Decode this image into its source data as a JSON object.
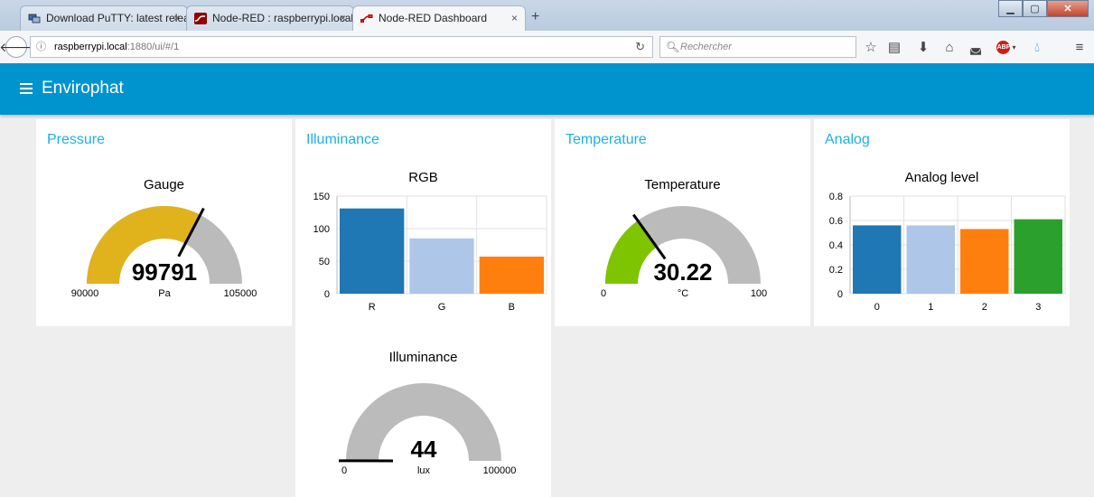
{
  "browser": {
    "tabs": [
      {
        "label": "Download PuTTY: latest relea",
        "close": "×"
      },
      {
        "label": "Node-RED : raspberrypi.local",
        "close": "×"
      },
      {
        "label": "Node-RED Dashboard",
        "close": "×"
      }
    ],
    "new_tab": "+",
    "url_host": "raspberrypi.local",
    "url_rest": ":1880/ui/#/1",
    "search_placeholder": "Rechercher",
    "abp_label": "ABP"
  },
  "app": {
    "title": "Envirophat"
  },
  "groups": {
    "pressure": {
      "title": "Pressure",
      "gauge": {
        "title": "Gauge",
        "value": "99791",
        "value_num": 99791,
        "unit": "Pa",
        "min": "90000",
        "min_num": 90000,
        "max": "105000",
        "max_num": 105000,
        "color": "#e0b21c"
      }
    },
    "illuminance": {
      "title": "Illuminance",
      "gauge": {
        "title": "Illuminance",
        "value": "44",
        "value_num": 44,
        "unit": "lux",
        "min": "0",
        "min_num": 0,
        "max": "100000",
        "max_num": 100000,
        "color": "#000000"
      }
    },
    "temperature": {
      "title": "Temperature",
      "gauge": {
        "title": "Temperature",
        "value": "30.22",
        "value_num": 30.22,
        "unit": "°C",
        "min": "0",
        "min_num": 0,
        "max": "100",
        "max_num": 100,
        "color": "#7ec400"
      }
    },
    "analog": {
      "title": "Analog"
    }
  },
  "chart_data": [
    {
      "type": "bar",
      "title": "RGB",
      "categories": [
        "R",
        "G",
        "B"
      ],
      "values": [
        131,
        85,
        57
      ],
      "colors": [
        "#1f77b4",
        "#aec7e8",
        "#ff7f0e"
      ],
      "yticks": [
        "0",
        "50",
        "100",
        "150"
      ],
      "ylim": [
        0,
        150
      ],
      "grid": true
    },
    {
      "type": "bar",
      "title": "Analog level",
      "categories": [
        "0",
        "1",
        "2",
        "3"
      ],
      "values": [
        0.56,
        0.56,
        0.53,
        0.61
      ],
      "colors": [
        "#1f77b4",
        "#aec7e8",
        "#ff7f0e",
        "#2ca02c"
      ],
      "yticks": [
        "0",
        "0.2",
        "0.4",
        "0.6",
        "0.8"
      ],
      "ylim": [
        0,
        0.8
      ],
      "grid": true
    }
  ]
}
